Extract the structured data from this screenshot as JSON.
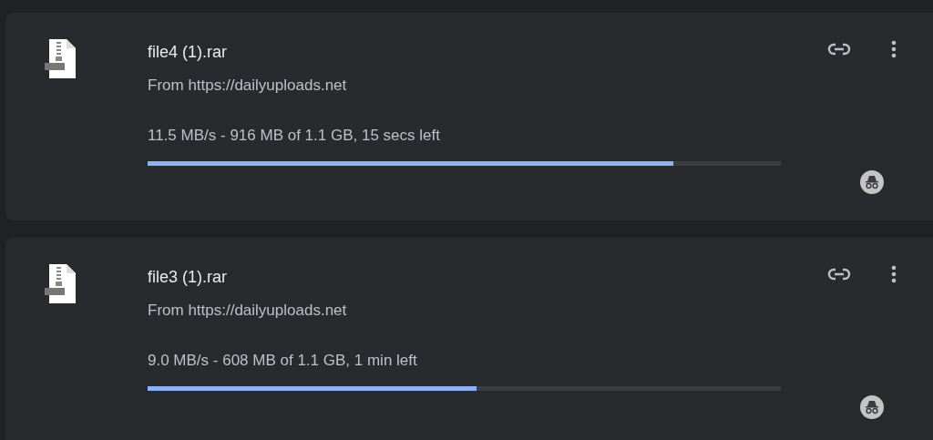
{
  "downloads": [
    {
      "file_name": "file4 (1).rar",
      "source": "From https://dailyuploads.net",
      "status": "11.5 MB/s - 916 MB of 1.1 GB, 15 secs left",
      "level": 0.83,
      "incognito": true
    },
    {
      "file_name": "file3 (1).rar",
      "source": "From https://dailyuploads.net",
      "status": "9.0 MB/s - 608 MB of 1.1 GB, 1 min left",
      "level": 0.52,
      "incognito": true
    }
  ]
}
